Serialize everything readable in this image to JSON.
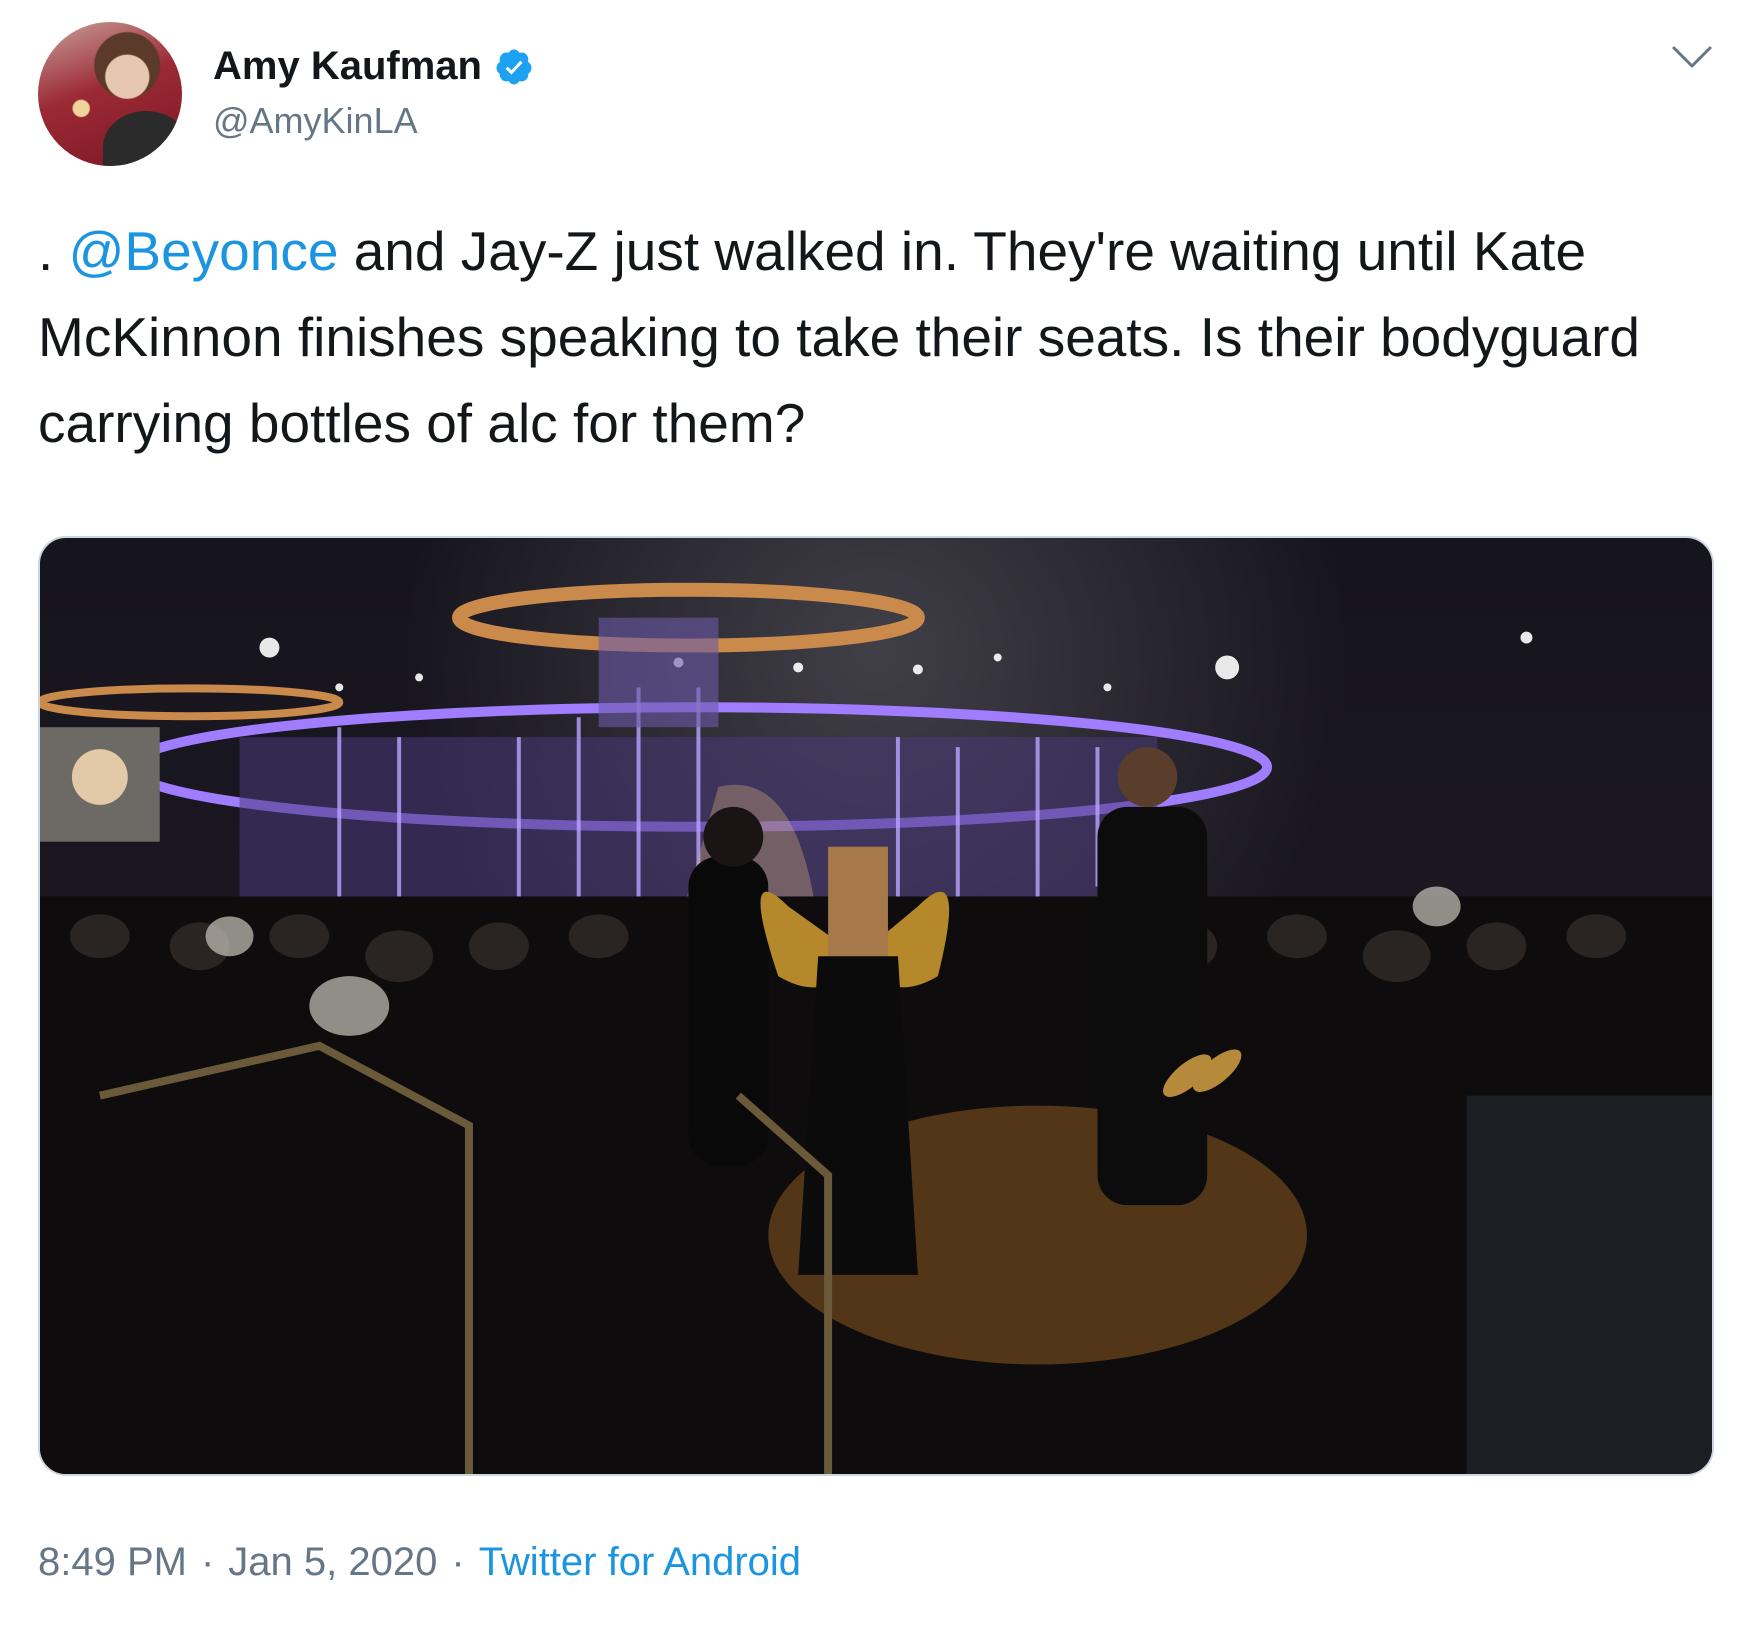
{
  "author": {
    "display_name": "Amy Kaufman",
    "handle": "@AmyKinLA",
    "verified_icon": "verified-badge-icon"
  },
  "menu": {
    "icon": "chevron-down-icon"
  },
  "tweet": {
    "prefix": ". ",
    "mention": "@Beyonce",
    "text_rest": " and Jay-Z just walked in. They're waiting until Kate McKinnon finishes speaking to take their seats. Is their bodyguard carrying bottles of alc for them?"
  },
  "media": {
    "type": "photo"
  },
  "meta": {
    "time": "8:49 PM",
    "separator": "·",
    "date": "Jan 5, 2020",
    "source": "Twitter for Android"
  },
  "colors": {
    "link": "#1b95e0",
    "text": "#14171a",
    "secondary": "#657786",
    "verified": "#1da1f2"
  }
}
